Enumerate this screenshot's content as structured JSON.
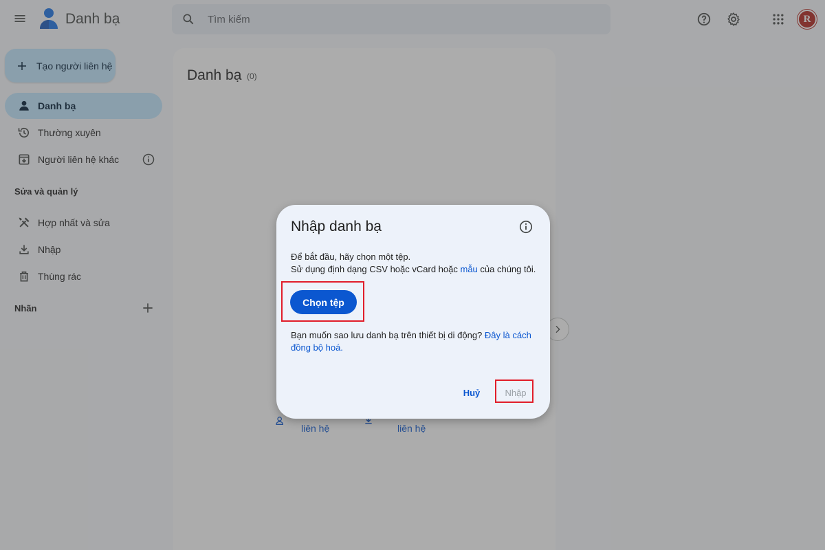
{
  "header": {
    "app_title": "Danh bạ",
    "search_placeholder": "Tìm kiếm",
    "avatar_initial": "R"
  },
  "sidebar": {
    "create_label": "Tạo người liên hệ",
    "items": [
      {
        "label": "Danh bạ",
        "icon": "person-icon"
      },
      {
        "label": "Thường xuyên",
        "icon": "history-icon"
      },
      {
        "label": "Người liên hệ khác",
        "icon": "archive-download-icon"
      }
    ],
    "manage_section": "Sửa và quản lý",
    "manage_items": [
      {
        "label": "Hợp nhất và sửa",
        "icon": "tools-icon"
      },
      {
        "label": "Nhập",
        "icon": "download-icon"
      },
      {
        "label": "Thùng rác",
        "icon": "trash-icon"
      }
    ],
    "labels_section": "Nhãn"
  },
  "main": {
    "title": "Danh bạ",
    "count": "(0)",
    "empty_actions": [
      {
        "label": "liên hệ",
        "icon": "person-add-icon"
      },
      {
        "label": "liên hệ",
        "icon": "download-icon"
      }
    ]
  },
  "dialog": {
    "title": "Nhập danh bạ",
    "line1": "Để bắt đầu, hãy chọn một tệp.",
    "line2_prefix": "Sử dụng định dạng CSV hoặc vCard hoặc ",
    "line2_link": "mẫu",
    "line2_suffix": " của chúng tôi.",
    "choose_file": "Chọn tệp",
    "mobile_text": "Bạn muốn sao lưu danh bạ trên thiết bị di động? ",
    "mobile_link": "Đây là cách đồng bộ hoá.",
    "cancel": "Huỷ",
    "import": "Nhập"
  },
  "colors": {
    "accent": "#0b57d0",
    "active_nav": "#c2e7ff",
    "highlight": "#e11d2a",
    "avatar": "#b3261e"
  }
}
